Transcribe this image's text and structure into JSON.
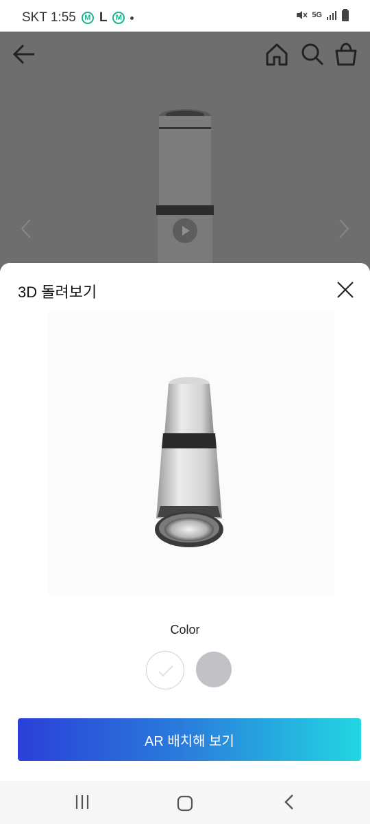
{
  "status_bar": {
    "carrier_time": "SKT 1:55",
    "badge_m": "M",
    "badge_l": "L",
    "network": "5G"
  },
  "header_icons": [
    "back-arrow-icon",
    "home-icon",
    "search-icon",
    "cart-icon"
  ],
  "sheet": {
    "title": "3D 돌려보기",
    "color_label": "Color",
    "colors": [
      "#ffffff",
      "#c2c1c6"
    ],
    "selected_color_index": 0,
    "ar_button_label": "AR 배치해 보기",
    "ar_gradient": [
      "#2b3fd8",
      "#22d6e2"
    ]
  },
  "nav_bar": [
    "recent-apps-icon",
    "home-button-icon",
    "back-icon"
  ]
}
